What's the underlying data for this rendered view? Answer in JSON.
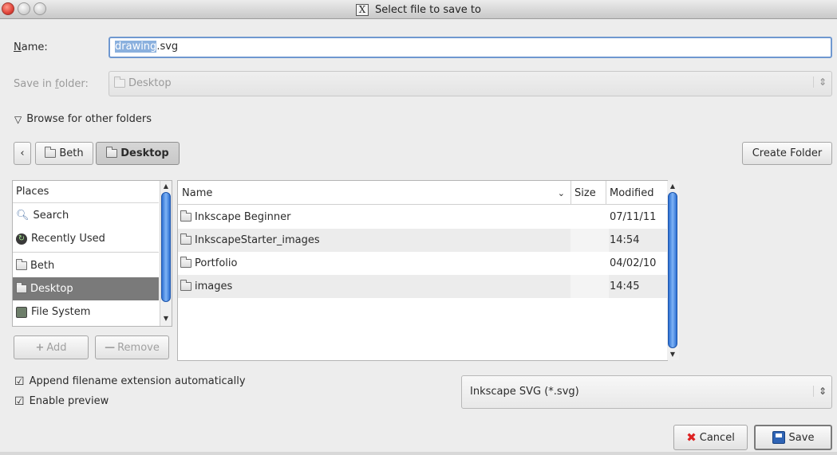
{
  "window": {
    "title": "Select file to save to"
  },
  "name_field": {
    "label": "Name:",
    "value_selected": "drawing",
    "value_rest": ".svg"
  },
  "save_in": {
    "label": "Save in folder:",
    "value": "Desktop"
  },
  "browse_toggle": {
    "label": "Browse for other folders",
    "expanded": true
  },
  "path_bar": {
    "back_glyph": "‹",
    "crumbs": [
      "Beth",
      "Desktop"
    ],
    "create_folder_label": "Create Folder"
  },
  "places": {
    "header": "Places",
    "items": [
      {
        "label": "Search",
        "icon": "search-icon",
        "selected": false
      },
      {
        "label": "Recently Used",
        "icon": "recent-icon",
        "selected": false
      },
      {
        "label": "Beth",
        "icon": "folder-icon",
        "selected": false
      },
      {
        "label": "Desktop",
        "icon": "folder-icon",
        "selected": true
      },
      {
        "label": "File System",
        "icon": "drive-icon",
        "selected": false
      }
    ],
    "add_label": "Add",
    "remove_label": "Remove"
  },
  "files": {
    "columns": {
      "name": "Name",
      "size": "Size",
      "modified": "Modified"
    },
    "rows": [
      {
        "name": "Inkscape Beginner",
        "size": "",
        "modified": "07/11/11"
      },
      {
        "name": "InkscapeStarter_images",
        "size": "",
        "modified": "14:54"
      },
      {
        "name": "Portfolio",
        "size": "",
        "modified": "04/02/10"
      },
      {
        "name": "images",
        "size": "",
        "modified": "14:45"
      }
    ]
  },
  "options": {
    "append_extension": {
      "label": "Append filename extension automatically",
      "checked": true
    },
    "enable_preview": {
      "label": "Enable preview",
      "checked": true
    }
  },
  "filter": {
    "value": "Inkscape SVG (*.svg)"
  },
  "buttons": {
    "cancel": "Cancel",
    "save": "Save"
  },
  "colors": {
    "selection": "#7a7a7a",
    "scroll_thumb": "#3b7ddd",
    "name_focus": "#6f98d0"
  }
}
